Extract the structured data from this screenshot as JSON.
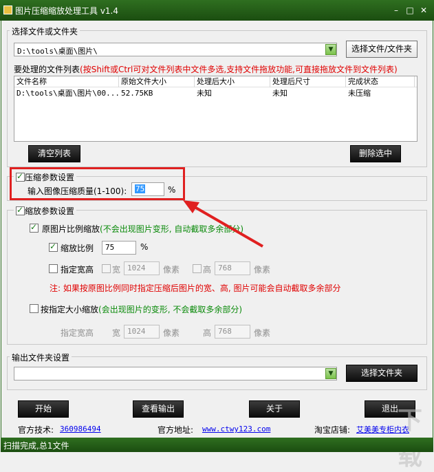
{
  "window": {
    "title": "图片压缩缩放处理工具 v1.4",
    "controls": {
      "minimize": "–",
      "maximize": "□",
      "close": "✕"
    }
  },
  "source": {
    "group_label": "选择文件或文件夹",
    "path_value": "D:\\tools\\桌面\\图片\\",
    "choose_button": "选择文件/文件夹",
    "list_label": "要处理的文件列表",
    "list_hint": "(按Shift或Ctrl可对文件列表中文件多选,支持文件拖放功能,可直接拖放文件到文件列表)",
    "columns": [
      "文件名称",
      "原始文件大小",
      "处理后大小",
      "处理后尺寸",
      "完成状态"
    ],
    "rows": [
      [
        "D:\\tools\\桌面\\图片\\00...",
        "52.75KB",
        "未知",
        "未知",
        "未压缩"
      ]
    ],
    "clear_button": "清空列表",
    "delete_button": "删除选中"
  },
  "compress": {
    "checkbox_label": "压缩参数设置",
    "checked": true,
    "quality_label": "输入图像压缩质量(1-100):",
    "quality_value": "75",
    "unit": "%"
  },
  "scale": {
    "checkbox_label": "缩放参数设置",
    "checked": true,
    "proportional_label": "原图片比例缩放",
    "proportional_note": "(不会出现图片变形, 自动截取多余部分)",
    "proportional_checked": true,
    "ratio_label": "缩放比例",
    "ratio_checked": true,
    "ratio_value": "75",
    "ratio_unit": "%",
    "fixed_wh_label": "指定宽高",
    "fixed_wh_checked": false,
    "width_label": "宽",
    "width_value": "1024",
    "pixel_unit": "像素",
    "height_label": "高",
    "height_value": "768",
    "note": "注: 如果按原图比例同时指定压缩后图片的宽、高, 图片可能会自动截取多余部分",
    "size_label": "按指定大小缩放",
    "size_note": "(会出现图片的变形, 不会截取多余部分)",
    "size_checked": false,
    "size_fixed_label": "指定宽高",
    "size_width_label": "宽",
    "size_width_value": "1024",
    "size_pixel_unit": "像素",
    "size_height_label": "高",
    "size_height_value": "768"
  },
  "output": {
    "group_label": "输出文件夹设置",
    "path_value": "",
    "choose_button": "选择文件夹"
  },
  "actions": {
    "start": "开始",
    "view_output": "查看输出",
    "about": "关于",
    "exit": "退出"
  },
  "footer": {
    "support_label": "官方技术:",
    "support_value": "360986494",
    "site_label": "官方地址:",
    "site_value": "www.ctwy123.com",
    "shop_label": "淘宝店铺:",
    "shop_value": "艾美美专柜内衣"
  },
  "status": {
    "text": "扫描完成,总1文件"
  },
  "watermark": "下载"
}
